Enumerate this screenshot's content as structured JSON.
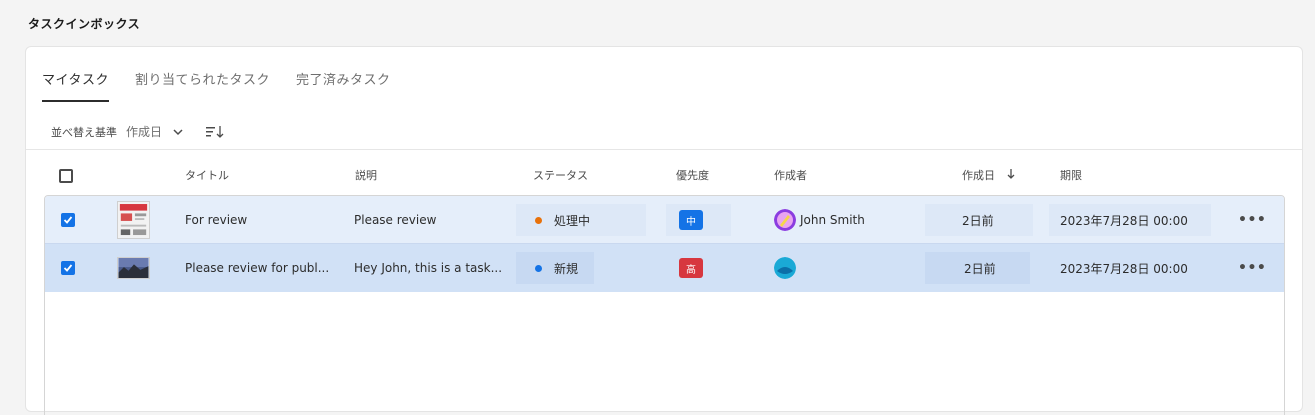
{
  "page": {
    "title": "タスクインボックス"
  },
  "tabs": [
    {
      "label": "マイタスク",
      "active": true
    },
    {
      "label": "割り当てられたタスク",
      "active": false
    },
    {
      "label": "完了済みタスク",
      "active": false
    }
  ],
  "sort": {
    "label": "並べ替え基準",
    "value": "作成日"
  },
  "columns": {
    "title": "タイトル",
    "description": "説明",
    "status": "ステータス",
    "priority": "優先度",
    "creator": "作成者",
    "created": "作成日",
    "due": "期限"
  },
  "rows": [
    {
      "checked": true,
      "thumbnail": "document-thumbnail",
      "title": "For review",
      "description": "Please review",
      "status": "処理中",
      "status_color": "#e8710a",
      "priority": "中",
      "priority_color": "#1473e6",
      "creator": "John Smith",
      "avatar": "pencil-avatar",
      "created": "2日前",
      "due": "2023年7月28日 00:00"
    },
    {
      "checked": true,
      "thumbnail": "landscape-thumbnail",
      "title": "Please review for publ...",
      "description": "Hey John, this is a task...",
      "status": "新規",
      "status_color": "#1473e6",
      "priority": "高",
      "priority_color": "#d7373f",
      "creator": "",
      "avatar": "blue-avatar",
      "created": "2日前",
      "due": "2023年7月28日 00:00"
    }
  ],
  "colors": {
    "accent": "#1473e6",
    "row_selected": "#d1e1f6"
  }
}
